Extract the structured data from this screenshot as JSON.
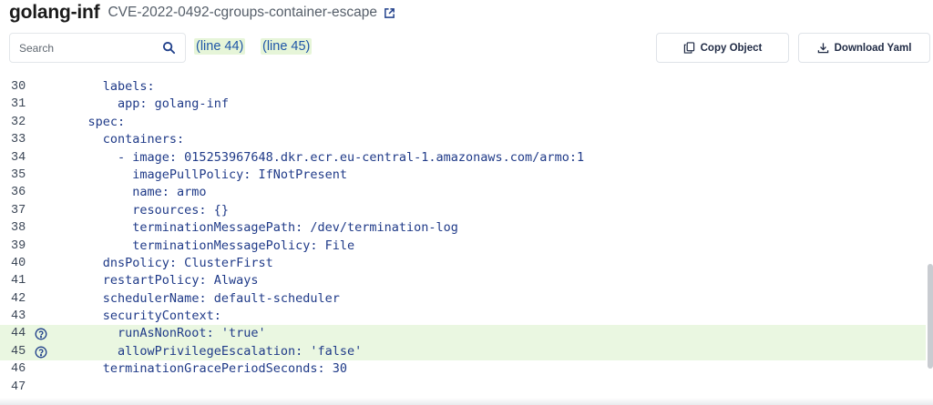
{
  "header": {
    "title": "golang-inf",
    "subtitle": "CVE-2022-0492-cgroups-container-escape"
  },
  "search": {
    "placeholder": "Search",
    "value": ""
  },
  "line_links": [
    "(line 44)",
    "(line 45)"
  ],
  "buttons": {
    "copy_label": "Copy Object",
    "download_label": "Download Yaml"
  },
  "code": {
    "lines": [
      {
        "num": "30",
        "indent": "      ",
        "text": "labels:",
        "highlight": false
      },
      {
        "num": "31",
        "indent": "        ",
        "text": "app: golang-inf",
        "highlight": false
      },
      {
        "num": "32",
        "indent": "    ",
        "text": "spec:",
        "highlight": false
      },
      {
        "num": "33",
        "indent": "      ",
        "text": "containers:",
        "highlight": false
      },
      {
        "num": "34",
        "indent": "        ",
        "text": "- image: 015253967648.dkr.ecr.eu-central-1.amazonaws.com/armo:1",
        "highlight": false
      },
      {
        "num": "35",
        "indent": "          ",
        "text": "imagePullPolicy: IfNotPresent",
        "highlight": false
      },
      {
        "num": "36",
        "indent": "          ",
        "text": "name: armo",
        "highlight": false
      },
      {
        "num": "37",
        "indent": "          ",
        "text": "resources: {}",
        "highlight": false
      },
      {
        "num": "38",
        "indent": "          ",
        "text": "terminationMessagePath: /dev/termination-log",
        "highlight": false
      },
      {
        "num": "39",
        "indent": "          ",
        "text": "terminationMessagePolicy: File",
        "highlight": false
      },
      {
        "num": "40",
        "indent": "      ",
        "text": "dnsPolicy: ClusterFirst",
        "highlight": false
      },
      {
        "num": "41",
        "indent": "      ",
        "text": "restartPolicy: Always",
        "highlight": false
      },
      {
        "num": "42",
        "indent": "      ",
        "text": "schedulerName: default-scheduler",
        "highlight": false
      },
      {
        "num": "43",
        "indent": "      ",
        "text": "securityContext:",
        "highlight": false
      },
      {
        "num": "44",
        "indent": "        ",
        "text": "runAsNonRoot: 'true'",
        "highlight": true
      },
      {
        "num": "45",
        "indent": "        ",
        "text": "allowPrivilegeEscalation: 'false'",
        "highlight": true
      },
      {
        "num": "46",
        "indent": "      ",
        "text": "terminationGracePeriodSeconds: 30",
        "highlight": false
      },
      {
        "num": "47",
        "indent": "",
        "text": "",
        "highlight": false
      }
    ]
  },
  "colors": {
    "highlight_bg": "#eaf7e1",
    "code_text": "#1f3a88",
    "link_text": "#1f56a8"
  },
  "icons": {
    "external_link": "external-link-icon",
    "search": "search-icon",
    "copy": "copy-icon",
    "download": "download-icon",
    "help": "help-circle-icon"
  }
}
